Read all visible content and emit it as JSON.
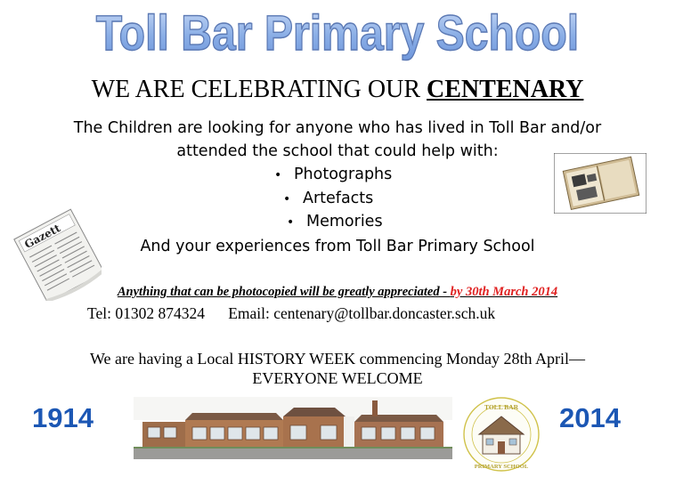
{
  "title": "Toll Bar Primary School",
  "celebrating": {
    "prefix": "WE ARE CELEBRATING OUR ",
    "highlight": "CENTENARY"
  },
  "intro": [
    "The Children are looking for anyone who has lived in Toll Bar and/or",
    "attended the school that could help with:"
  ],
  "bullets": [
    "Photographs",
    "Artefacts",
    "Memories"
  ],
  "experiences": "And your experiences from Toll Bar Primary School",
  "appeal": {
    "text": "Anything that can be photocopied will be greatly appreciated - ",
    "deadline": "by 30th March 2014"
  },
  "contact": {
    "tel": "Tel: 01302 874324",
    "email": "Email: centenary@tollbar.doncaster.sch.uk"
  },
  "history": [
    "We are having a Local HISTORY WEEK commencing Monday 28th April—",
    "EVERYONE WELCOME"
  ],
  "years": {
    "start": "1914",
    "end": "2014"
  },
  "images": {
    "newspaper": "newspaper-image",
    "album": "photo-album-image",
    "school": "school-building-photo",
    "logo": "school-logo"
  },
  "colors": {
    "title": "#8fb0e8",
    "year": "#1c57b4",
    "deadline": "#e02020"
  },
  "logo_text": {
    "top": "TOLL BAR",
    "bottom": "PRIMARY SCHOOL"
  },
  "newspaper_masthead": "Gazett"
}
